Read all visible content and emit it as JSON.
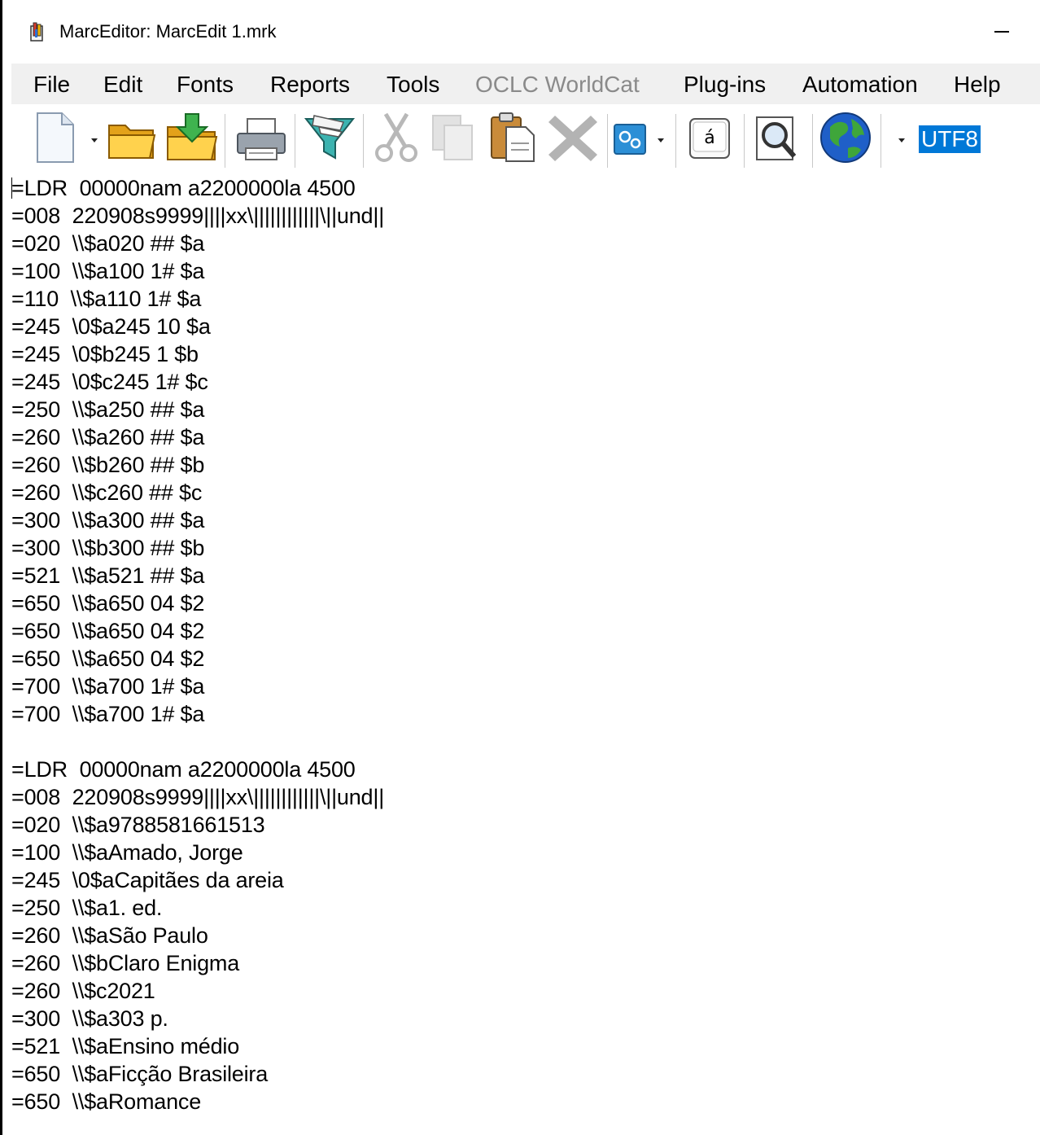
{
  "window": {
    "title": "MarcEditor: MarcEdit 1.mrk"
  },
  "menu": {
    "file": "File",
    "edit": "Edit",
    "fonts": "Fonts",
    "reports": "Reports",
    "tools": "Tools",
    "oclc": "OCLC WorldCat",
    "plugins": "Plug-ins",
    "automation": "Automation",
    "help": "Help"
  },
  "toolbar": {
    "icons": [
      "new-document-icon",
      "open-folder-icon",
      "open-folder-download-icon",
      "print-icon",
      "filter-funnel-icon",
      "cut-scissors-icon",
      "copy-icon",
      "paste-clipboard-icon",
      "delete-x-icon",
      "settings-gears-icon",
      "special-character-a-acute-icon",
      "find-magnifier-icon",
      "globe-icon"
    ],
    "special_char": "á",
    "encoding": "UTF8"
  },
  "editor": {
    "lines": [
      "=LDR  00000nam a2200000la 4500",
      "=008  220908s9999||||xx\\||||||||||||\\||und||",
      "=020  \\\\$a020 ## $a",
      "=100  \\\\$a100 1# $a",
      "=110  \\\\$a110 1# $a",
      "=245  \\0$a245 10 $a",
      "=245  \\0$b245 1 $b",
      "=245  \\0$c245 1# $c",
      "=250  \\\\$a250 ## $a",
      "=260  \\\\$a260 ## $a",
      "=260  \\\\$b260 ## $b",
      "=260  \\\\$c260 ## $c",
      "=300  \\\\$a300 ## $a",
      "=300  \\\\$b300 ## $b",
      "=521  \\\\$a521 ## $a",
      "=650  \\\\$a650 04 $2",
      "=650  \\\\$a650 04 $2",
      "=650  \\\\$a650 04 $2",
      "=700  \\\\$a700 1# $a",
      "=700  \\\\$a700 1# $a",
      "",
      "=LDR  00000nam a2200000la 4500",
      "=008  220908s9999||||xx\\||||||||||||\\||und||",
      "=020  \\\\$a9788581661513",
      "=100  \\\\$aAmado, Jorge",
      "=245  \\0$aCapitães da areia",
      "=250  \\\\$a1. ed.",
      "=260  \\\\$aSão Paulo",
      "=260  \\\\$bClaro Enigma",
      "=260  \\\\$c2021",
      "=300  \\\\$a303 p.",
      "=521  \\\\$aEnsino médio",
      "=650  \\\\$aFicção Brasileira",
      "=650  \\\\$aRomance"
    ]
  }
}
